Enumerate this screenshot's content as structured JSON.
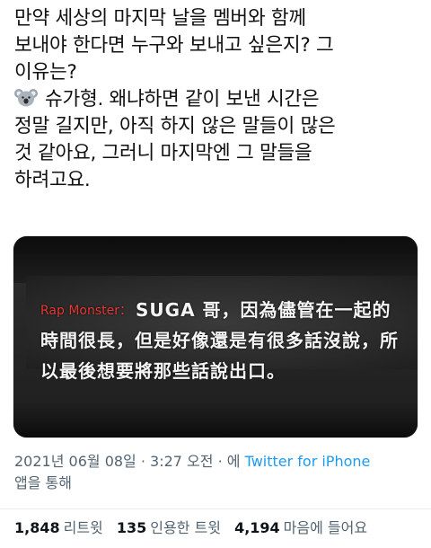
{
  "tweet": {
    "lines": [
      "만약 세상의 마지막 날을 멤버와 함께",
      "보내야 한다면 누구와 보내고 싶은지? 그",
      "이유는?",
      "슈가형. 왜냐하면 같이 보낸 시간은",
      "정말 길지만, 아직 하지 않은 말들이 많은",
      "것 같아요, 그러니 마지막엔 그 말들을",
      "하려고요."
    ],
    "emoji_icon": "koala-emoji"
  },
  "media": {
    "speaker": "Rap Monster：",
    "line1": "SUGA 哥，因為儘管在一起的",
    "line2": "時間很長，但是好像還是有很多話沒說，所",
    "line3": "以最後想要將那些話說出口。"
  },
  "meta": {
    "timestamp": "2021년 06월 08일 · 3:27 오전 · 에",
    "source": "Twitter for iPhone",
    "suffix": "앱을 통해"
  },
  "stats": {
    "retweets": "1,848",
    "retweets_label": "리트윗",
    "quotes": "135",
    "quotes_label": "인용한 트윗",
    "likes": "4,194",
    "likes_label": "마음에 들어요"
  },
  "colors": {
    "link": "#1d9bf0",
    "meta_text": "#536471",
    "speaker": "#e53935"
  }
}
